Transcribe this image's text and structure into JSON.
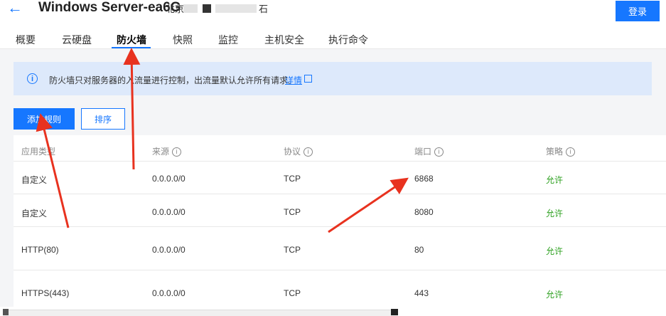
{
  "header": {
    "back_icon": "arrow-left-icon",
    "title": "Windows Server-ea6G",
    "region": "北京",
    "region_tail": "石",
    "login_label": "登录"
  },
  "tabs": [
    {
      "label": "概要"
    },
    {
      "label": "云硬盘"
    },
    {
      "label": "防火墙",
      "active": true
    },
    {
      "label": "快照"
    },
    {
      "label": "监控"
    },
    {
      "label": "主机安全"
    },
    {
      "label": "执行命令"
    }
  ],
  "notice": {
    "icon": "info-icon",
    "text": "防火墙只对服务器的入流量进行控制，出流量默认允许所有请求。",
    "link": "详情",
    "link_icon": "external-link-icon"
  },
  "toolbar": {
    "add_label": "添加规则",
    "sort_label": "排序"
  },
  "table": {
    "headers": [
      "应用类型",
      "来源",
      "协议",
      "端口",
      "策略"
    ],
    "rows": [
      {
        "app": "自定义",
        "source": "0.0.0.0/0",
        "protocol": "TCP",
        "port": "6868",
        "policy": "允许"
      },
      {
        "app": "自定义",
        "source": "0.0.0.0/0",
        "protocol": "TCP",
        "port": "8080",
        "policy": "允许"
      },
      {
        "app": "HTTP(80)",
        "source": "0.0.0.0/0",
        "protocol": "TCP",
        "port": "80",
        "policy": "允许"
      },
      {
        "app": "HTTPS(443)",
        "source": "0.0.0.0/0",
        "protocol": "TCP",
        "port": "443",
        "policy": "允许"
      }
    ]
  },
  "colors": {
    "accent": "#1677ff",
    "allow": "#2ea121",
    "annotation_arrow": "#e8321f"
  }
}
